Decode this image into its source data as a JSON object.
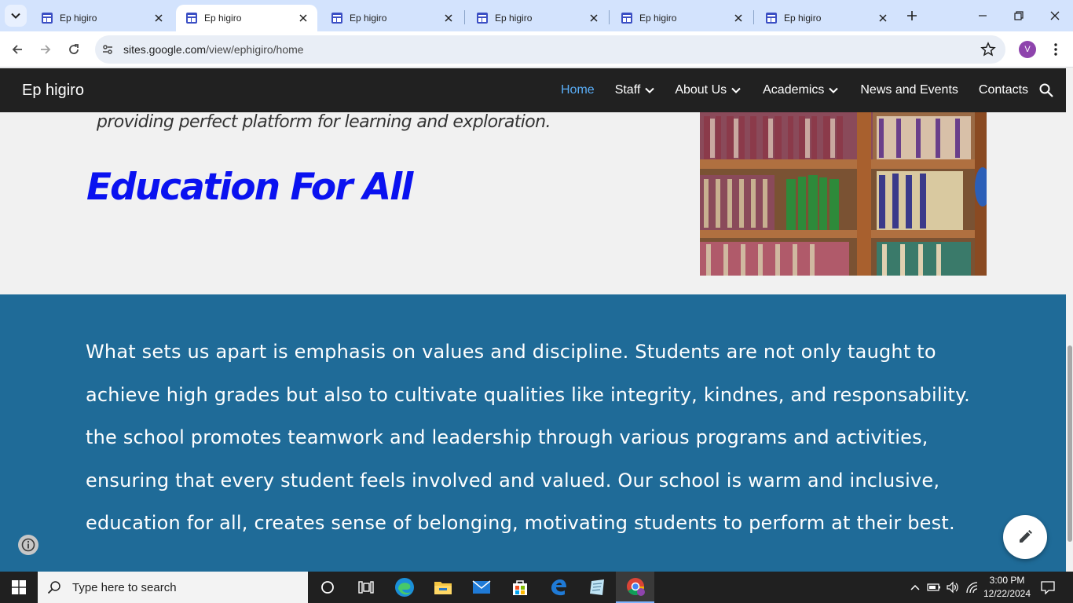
{
  "browser": {
    "tabs": [
      {
        "title": "Ep higiro",
        "active": false
      },
      {
        "title": "Ep higiro",
        "active": true
      },
      {
        "title": "Ep higiro",
        "active": false
      },
      {
        "title": "Ep higiro",
        "active": false
      },
      {
        "title": "Ep higiro",
        "active": false
      },
      {
        "title": "Ep higiro",
        "active": false
      }
    ],
    "url_host": "sites.google.com",
    "url_path": "/view/ephigiro/home",
    "profile_initial": "V"
  },
  "site": {
    "title": "Ep higiro",
    "nav": [
      {
        "label": "Home",
        "active": true,
        "dropdown": false
      },
      {
        "label": "Staff",
        "active": false,
        "dropdown": true
      },
      {
        "label": "About Us",
        "active": false,
        "dropdown": true
      },
      {
        "label": "Academics",
        "active": false,
        "dropdown": true
      },
      {
        "label": "News and Events",
        "active": false,
        "dropdown": false
      },
      {
        "label": "Contacts",
        "active": false,
        "dropdown": false
      }
    ]
  },
  "hero": {
    "tagline": "providing perfect platform for learning and exploration.",
    "headline": "Education For All",
    "headline_color": "#0a12f0"
  },
  "band": {
    "background": "#1f6b98",
    "lines": [
      "What sets us apart is emphasis on values and discipline. Students are not only taught to",
      "achieve high grades but also to cultivate qualities like integrity, kindnes, and responsability.",
      "the school promotes teamwork and leadership through various programs and activities,",
      "ensuring that every student feels involved and valued. Our school is warm and inclusive,",
      "education for all, creates sense of belonging, motivating students to perform at their best."
    ]
  },
  "taskbar": {
    "search_placeholder": "Type here to search",
    "time": "3:00 PM",
    "date": "12/22/2024",
    "pinned": [
      "cortana-icon",
      "task-view-icon",
      "edge-icon",
      "file-explorer-icon",
      "mail-icon",
      "store-icon",
      "edge-legacy-icon",
      "notepad-icon",
      "chrome-icon"
    ]
  }
}
